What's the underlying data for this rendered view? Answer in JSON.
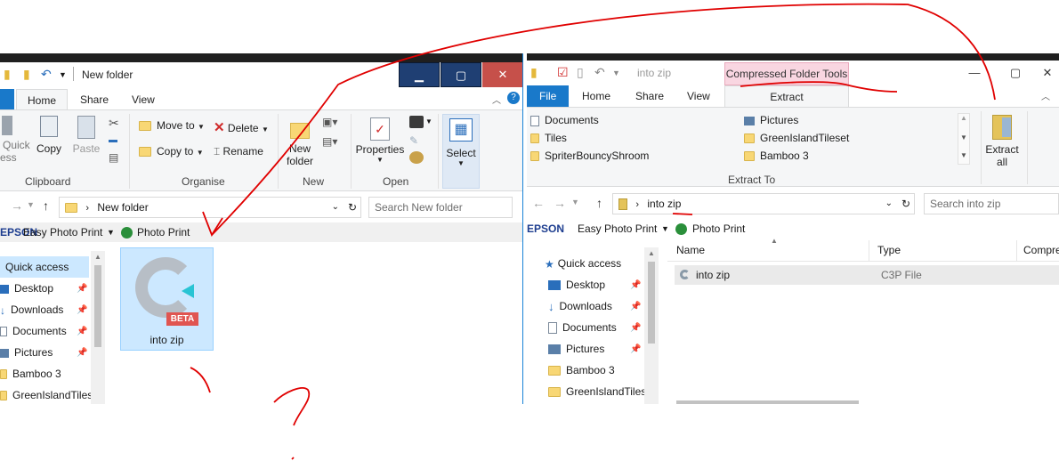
{
  "left_window": {
    "title": "New folder",
    "tabs": [
      "Home",
      "Share",
      "View"
    ],
    "ribbon": {
      "quick_label": "Quick",
      "quick_label2": "ess",
      "copy": "Copy",
      "paste": "Paste",
      "clipboard": "Clipboard",
      "move_to": "Move to",
      "copy_to": "Copy to",
      "delete": "Delete",
      "rename": "Rename",
      "organise": "Organise",
      "new_folder_1": "New",
      "new_folder_2": "folder",
      "new": "New",
      "properties": "Properties",
      "open": "Open",
      "select": "Select"
    },
    "address": "New folder",
    "search_placeholder": "Search New folder",
    "epson": {
      "brand": "EPSON",
      "easy": "Easy Photo Print",
      "photo": "Photo Print"
    },
    "nav": {
      "quick_access": "Quick access",
      "items": [
        "Desktop",
        "Downloads",
        "Documents",
        "Pictures",
        "Bamboo 3",
        "GreenIslandTiles"
      ]
    },
    "file": {
      "name": "into zip",
      "badge": "BETA"
    }
  },
  "right_window": {
    "title": "into zip",
    "context_tab": "Compressed Folder Tools",
    "tabs": [
      "File",
      "Home",
      "Share",
      "View"
    ],
    "extract_tab": "Extract",
    "destinations_col1": [
      "Documents",
      "Tiles",
      "SpriterBouncyShroom"
    ],
    "destinations_col2": [
      "Pictures",
      "GreenIslandTileset",
      "Bamboo 3"
    ],
    "extract_to": "Extract To",
    "extract_all_1": "Extract",
    "extract_all_2": "all",
    "address": "into zip",
    "search_placeholder": "Search into zip",
    "epson": {
      "brand": "EPSON",
      "easy": "Easy Photo Print",
      "photo": "Photo Print"
    },
    "nav": {
      "quick_access": "Quick access",
      "items": [
        "Desktop",
        "Downloads",
        "Documents",
        "Pictures",
        "Bamboo 3",
        "GreenIslandTiles"
      ]
    },
    "columns": [
      "Name",
      "Type",
      "Compre"
    ],
    "row": {
      "name": "into zip",
      "type": "C3P File"
    }
  },
  "colors": {
    "accent": "#1979ca",
    "annotation": "#e00000",
    "selection": "#cce8ff"
  }
}
